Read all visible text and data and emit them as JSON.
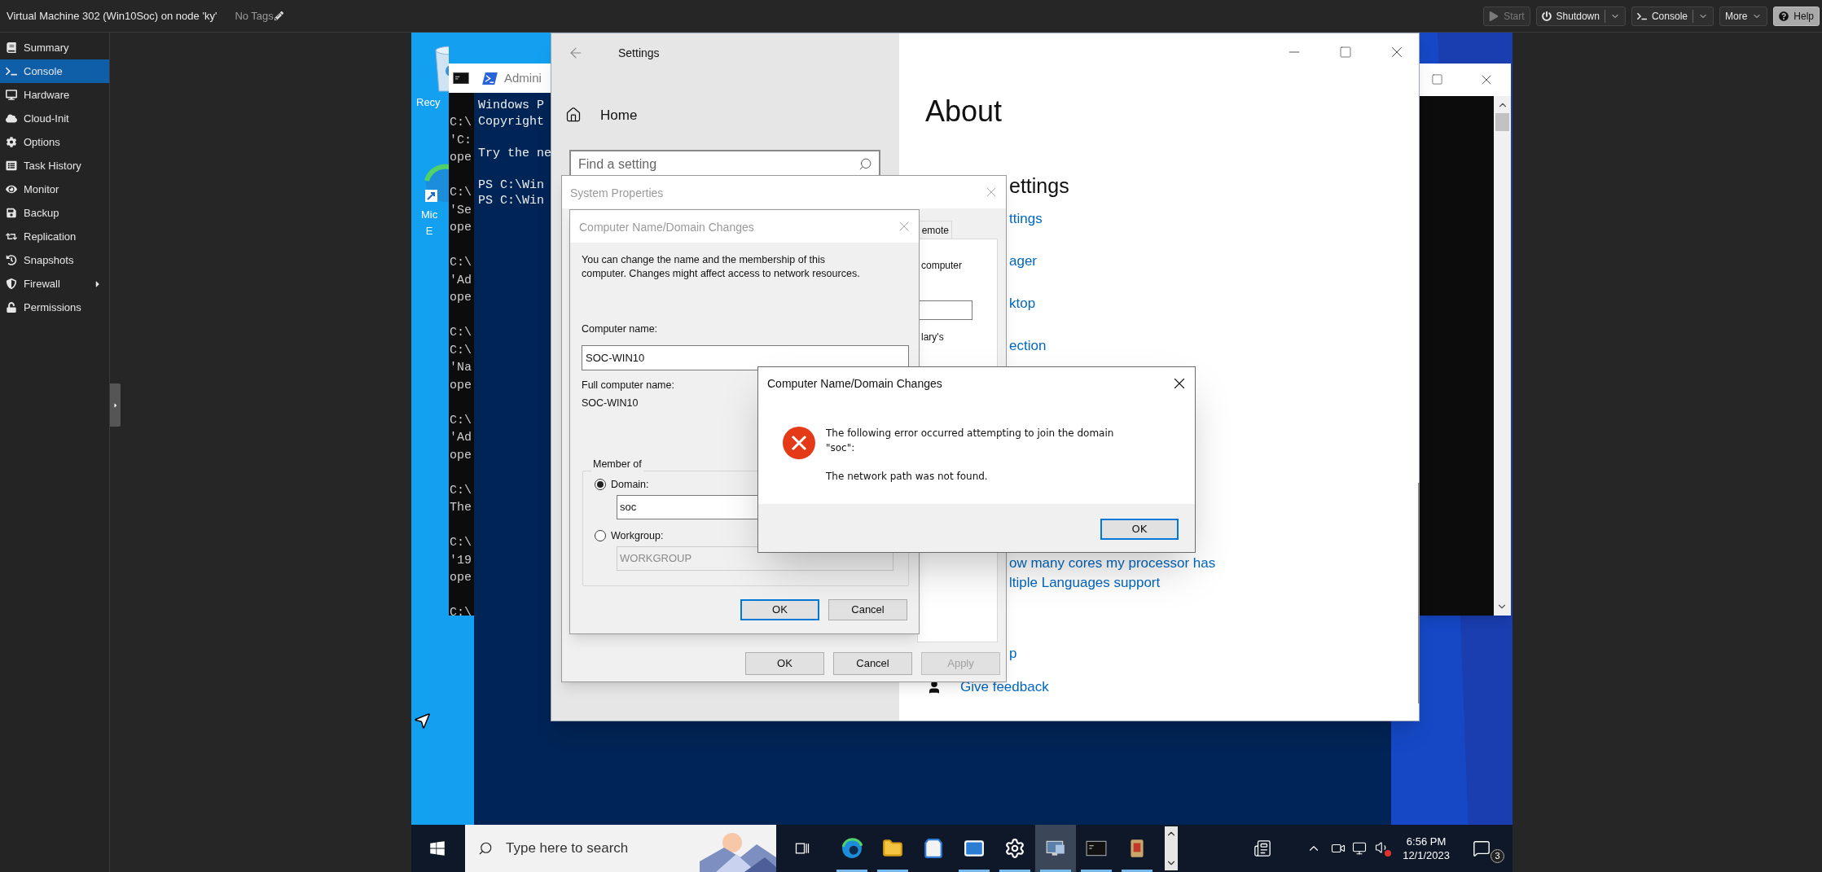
{
  "header": {
    "title": "Virtual Machine 302 (Win10Soc) on node 'ky'",
    "tags": "No Tags",
    "buttons": [
      {
        "kind": "start",
        "label": "Start",
        "disabled": true
      },
      {
        "kind": "shutdown",
        "label": "Shutdown",
        "disabled": false
      },
      {
        "kind": "console",
        "label": "Console",
        "disabled": false
      },
      {
        "kind": "more",
        "label": "More",
        "disabled": false
      },
      {
        "kind": "help",
        "label": "Help",
        "disabled": false
      }
    ]
  },
  "sidebar": {
    "items": [
      {
        "label": "Summary",
        "selected": false,
        "has_submenu": false
      },
      {
        "label": "Console",
        "selected": true,
        "has_submenu": false
      },
      {
        "label": "Hardware",
        "selected": false,
        "has_submenu": false
      },
      {
        "label": "Cloud-Init",
        "selected": false,
        "has_submenu": false
      },
      {
        "label": "Options",
        "selected": false,
        "has_submenu": false
      },
      {
        "label": "Task History",
        "selected": false,
        "has_submenu": false
      },
      {
        "label": "Monitor",
        "selected": false,
        "has_submenu": false
      },
      {
        "label": "Backup",
        "selected": false,
        "has_submenu": false
      },
      {
        "label": "Replication",
        "selected": false,
        "has_submenu": false
      },
      {
        "label": "Snapshots",
        "selected": false,
        "has_submenu": false
      },
      {
        "label": "Firewall",
        "selected": false,
        "has_submenu": true
      },
      {
        "label": "Permissions",
        "selected": false,
        "has_submenu": false
      }
    ]
  },
  "desktop": {
    "icons": [
      {
        "label_lines": [
          "Recy"
        ]
      },
      {
        "label_lines": [
          "Mic",
          "E"
        ]
      }
    ]
  },
  "cmd_window": {
    "line_groups": [
      [
        "C:\\",
        "'C:",
        "ope"
      ],
      [
        "C:\\",
        "'Se",
        "ope"
      ],
      [
        "C:\\",
        "'Ad",
        "ope"
      ],
      [
        "C:\\",
        "C:\\",
        "'Na",
        "ope"
      ],
      [
        "C:\\",
        "'Ad",
        "ope"
      ],
      [
        "C:\\",
        "The"
      ],
      [
        "C:\\",
        "'19",
        "ope"
      ],
      [
        "C:\\"
      ]
    ]
  },
  "powershell_window": {
    "title": "Admini",
    "line_groups": [
      [
        "Windows P",
        "Copyright"
      ],
      [
        "Try the ne"
      ],
      [
        "PS C:\\Win",
        "PS C:\\Win"
      ]
    ]
  },
  "settings": {
    "title": "Settings",
    "home": "Home",
    "search_placeholder": "Find a setting",
    "page_title": "About",
    "related_heading": "ettings",
    "links": [
      "ttings",
      "ager",
      "ktop",
      "ection",
      "ow many cores my processor has",
      "ltiple Languages support",
      "p"
    ],
    "feedback": "Give feedback"
  },
  "system_properties": {
    "title": "System Properties",
    "tab": "emote",
    "texts": [
      "computer",
      "lary's"
    ],
    "buttons": [
      {
        "label": "OK",
        "disabled": false
      },
      {
        "label": "Cancel",
        "disabled": false
      },
      {
        "label": "Apply",
        "disabled": true
      }
    ]
  },
  "name_dialog": {
    "title": "Computer Name/Domain Changes",
    "description_lines": [
      "You can change the name and the membership of this",
      "computer. Changes might affect access to network resources."
    ],
    "computer_name_label": "Computer name:",
    "computer_name": "SOC-WIN10",
    "full_name_label": "Full computer name:",
    "full_name": "SOC-WIN10",
    "member_of": "Member of",
    "member_options": [
      {
        "label": "Domain:",
        "value": "soc",
        "selected": true,
        "disabled": false
      },
      {
        "label": "Workgroup:",
        "value": "WORKGROUP",
        "selected": false,
        "disabled": true
      }
    ],
    "buttons": [
      {
        "label": "OK",
        "default": true
      },
      {
        "label": "Cancel",
        "default": false
      }
    ]
  },
  "error_dialog": {
    "title": "Computer Name/Domain Changes",
    "message_lines": [
      "The following error occurred attempting to join the domain",
      "\"soc\":"
    ],
    "detail": "The network path was not found.",
    "button": "OK"
  },
  "taskbar": {
    "search_placeholder": "Type here to search",
    "apps": [
      {
        "running": true,
        "selected": false
      },
      {
        "running": true,
        "selected": false
      },
      {
        "running": false,
        "selected": false
      },
      {
        "running": true,
        "selected": false
      },
      {
        "running": true,
        "selected": false
      },
      {
        "running": true,
        "selected": true
      },
      {
        "running": true,
        "selected": false
      },
      {
        "running": true,
        "selected": false
      }
    ],
    "time": "6:56 PM",
    "date": "12/1/2023",
    "notifications": "3"
  }
}
